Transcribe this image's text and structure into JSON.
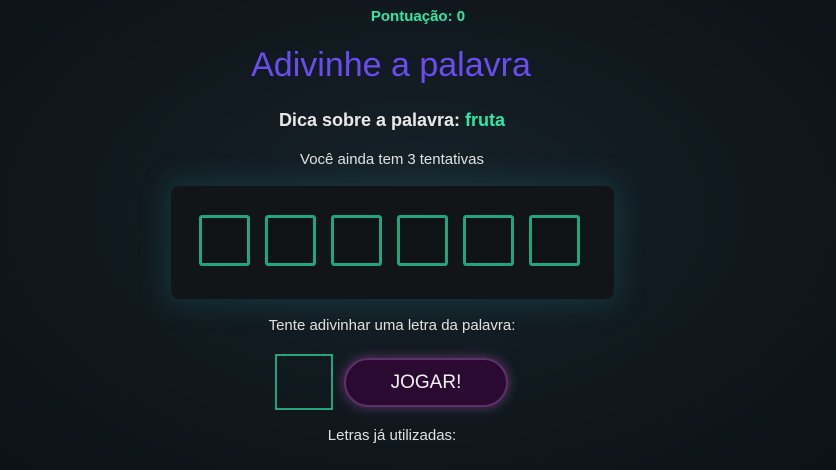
{
  "score": {
    "label": "Pontuação:",
    "value": "0"
  },
  "title": "Adivinhe a palavra",
  "hint": {
    "label": "Dica sobre a palavra:",
    "word": "fruta"
  },
  "attempts": {
    "prefix": "Você ainda tem",
    "count": "3",
    "suffix": "tentativas"
  },
  "word_slots": [
    "",
    "",
    "",
    "",
    "",
    ""
  ],
  "guess": {
    "prompt": "Tente adivinhar uma letra da palavra:",
    "input_value": "",
    "button_label": "JOGAR!"
  },
  "used_letters": {
    "label": "Letras já utilizadas:",
    "letters": ""
  },
  "colors": {
    "accent_green": "#2ee8a0",
    "title_purple": "#6a4cf0",
    "slot_border": "#1fa67a",
    "button_bg": "#2b0a32"
  }
}
